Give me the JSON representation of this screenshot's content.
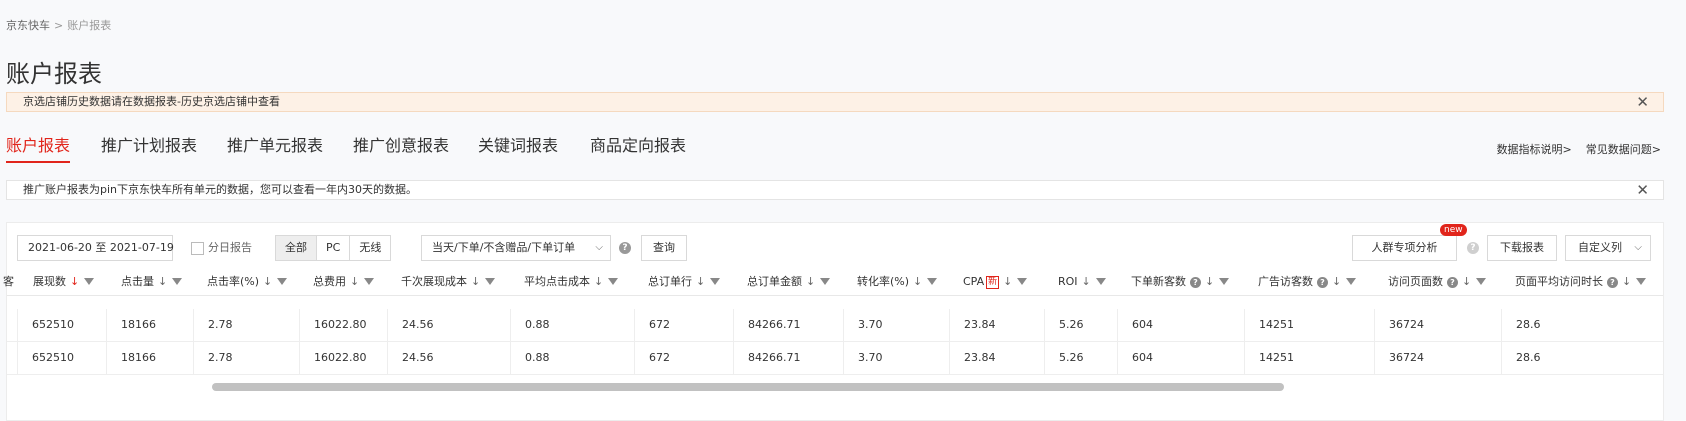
{
  "breadcrumb": {
    "root": "京东快车",
    "sep": ">",
    "current": "账户报表"
  },
  "page_title": "账户报表",
  "notice": {
    "text": "京选店铺历史数据请在数据报表-历史京选店铺中查看",
    "close_glyph": "✕"
  },
  "tabs": [
    {
      "label": "账户报表"
    },
    {
      "label": "推广计划报表"
    },
    {
      "label": "推广单元报表"
    },
    {
      "label": "推广创意报表"
    },
    {
      "label": "关键词报表"
    },
    {
      "label": "商品定向报表"
    }
  ],
  "help_links": [
    "数据指标说明>",
    "常见数据问题>"
  ],
  "info": {
    "text": "推广账户报表为pin下京东快车所有单元的数据，您可以查看一年内30天的数据。",
    "close_glyph": "✕"
  },
  "toolbar": {
    "date_range": "2021-06-20 至 2021-07-19",
    "daily_report_label": "分日报告",
    "device_options": [
      "全部",
      "PC",
      "无线"
    ],
    "device_selected": "全部",
    "order_select": "当天/下单/不含赠品/下单订单",
    "query_label": "查询",
    "audience_label": "人群专项分析",
    "new_badge": "new",
    "download_label": "下载报表",
    "custom_columns_label": "自定义列"
  },
  "table": {
    "leading_fragment": "客",
    "headers": [
      {
        "label": "展现数",
        "sort": "↓",
        "active": true
      },
      {
        "label": "点击量",
        "sort": "↓"
      },
      {
        "label": "点击率(%)",
        "sort": "↓"
      },
      {
        "label": "总费用",
        "sort": "↓"
      },
      {
        "label": "千次展现成本",
        "sort": "↓"
      },
      {
        "label": "平均点击成本",
        "sort": "↓"
      },
      {
        "label": "总订单行",
        "sort": "↓"
      },
      {
        "label": "总订单金额",
        "sort": "↓"
      },
      {
        "label": "转化率(%)",
        "sort": "↓"
      },
      {
        "label": "CPA",
        "badge": "新",
        "sort": "↓"
      },
      {
        "label": "ROI",
        "sort": "↓"
      },
      {
        "label": "下单新客数",
        "help": "?",
        "sort": "↓"
      },
      {
        "label": "广告访客数",
        "help": "?",
        "sort": "↓"
      },
      {
        "label": "访问页面数",
        "help": "?",
        "sort": "↓"
      },
      {
        "label": "页面平均访问时长",
        "help": "?",
        "sort": "↓"
      }
    ],
    "rows": [
      [
        "652510",
        "18166",
        "2.78",
        "16022.80",
        "24.56",
        "0.88",
        "672",
        "84266.71",
        "3.70",
        "23.84",
        "5.26",
        "604",
        "14251",
        "36724",
        "28.6"
      ],
      [
        "652510",
        "18166",
        "2.78",
        "16022.80",
        "24.56",
        "0.88",
        "672",
        "84266.71",
        "3.70",
        "23.84",
        "5.26",
        "604",
        "14251",
        "36724",
        "28.6"
      ]
    ]
  },
  "colors": {
    "accent": "#e1251b",
    "notice_bg": "#fdf1e6"
  }
}
